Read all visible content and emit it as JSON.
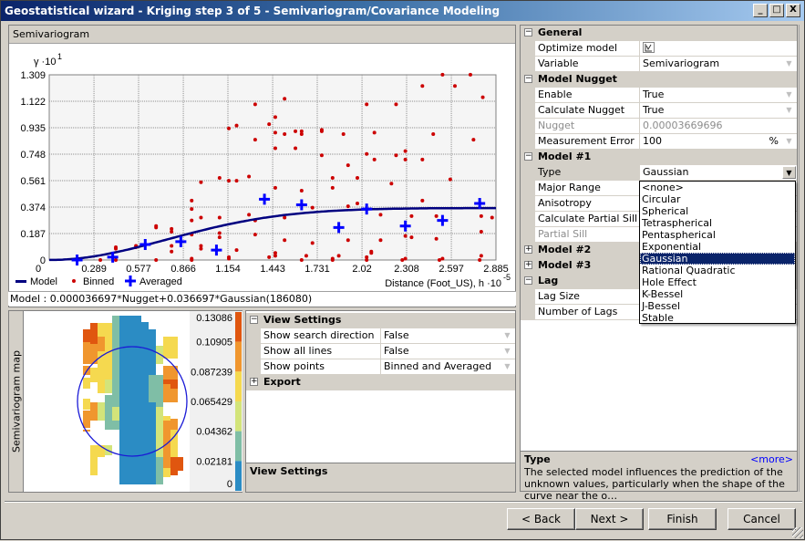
{
  "window": {
    "title": "Geostatistical wizard - Kriging step 3 of 5 - Semivariogram/Covariance Modeling",
    "controls": [
      "_",
      "□",
      "X"
    ]
  },
  "chart_panel": {
    "header": "Semivariogram",
    "model_text": "Model : 0.000036697*Nugget+0.036697*Gaussian(186080)"
  },
  "chart_data": {
    "type": "scatter",
    "title": "Semivariogram",
    "ylabel": "γ ·10",
    "ylabel_exp": "1",
    "xlabel": "Distance (Foot_US), h ·10",
    "xlabel_exp": "-5",
    "xlim": [
      0,
      2.885
    ],
    "ylim": [
      0,
      1.309
    ],
    "x_ticks": [
      "0",
      "0.289",
      "0.577",
      "0.866",
      "1.154",
      "1.443",
      "1.731",
      "2.02",
      "2.308",
      "2.597",
      "2.885"
    ],
    "y_ticks": [
      "0",
      "0.187",
      "0.374",
      "0.561",
      "0.748",
      "0.935",
      "1.122",
      "1.309"
    ],
    "grid": true,
    "legend": [
      {
        "name": "Model",
        "color": "#000080",
        "marker": "line"
      },
      {
        "name": "Binned",
        "color": "#cc0000",
        "marker": "dot"
      },
      {
        "name": "Averaged",
        "color": "#0000ff",
        "marker": "cross"
      }
    ],
    "legend_position": "bottom-left",
    "model": {
      "type": "gaussian",
      "nugget": 0.00036697,
      "partial_sill": 0.36697,
      "range": 1.8608
    },
    "averaged": [
      {
        "x": 0.18,
        "y": 0.0
      },
      {
        "x": 0.41,
        "y": 0.02
      },
      {
        "x": 0.62,
        "y": 0.11
      },
      {
        "x": 0.85,
        "y": 0.13
      },
      {
        "x": 1.08,
        "y": 0.07
      },
      {
        "x": 1.39,
        "y": 0.43
      },
      {
        "x": 1.63,
        "y": 0.39
      },
      {
        "x": 1.87,
        "y": 0.23
      },
      {
        "x": 2.05,
        "y": 0.36
      },
      {
        "x": 2.3,
        "y": 0.24
      },
      {
        "x": 2.54,
        "y": 0.28
      },
      {
        "x": 2.78,
        "y": 0.4
      }
    ],
    "binned": [
      {
        "x": 0.33,
        "y": 0.0
      },
      {
        "x": 0.43,
        "y": 0.09
      },
      {
        "x": 0.43,
        "y": 0.08
      },
      {
        "x": 0.43,
        "y": 0.0
      },
      {
        "x": 0.56,
        "y": 0.1
      },
      {
        "x": 0.56,
        "y": 0.09
      },
      {
        "x": 0.69,
        "y": 0.24
      },
      {
        "x": 0.69,
        "y": 0.23
      },
      {
        "x": 0.69,
        "y": 0.0
      },
      {
        "x": 0.79,
        "y": 0.22
      },
      {
        "x": 0.79,
        "y": 0.2
      },
      {
        "x": 0.79,
        "y": 0.1
      },
      {
        "x": 0.79,
        "y": 0.06
      },
      {
        "x": 0.92,
        "y": 0.42
      },
      {
        "x": 0.92,
        "y": 0.36
      },
      {
        "x": 0.92,
        "y": 0.28
      },
      {
        "x": 0.92,
        "y": 0.18
      },
      {
        "x": 0.92,
        "y": 0.0
      },
      {
        "x": 0.92,
        "y": 0.01
      },
      {
        "x": 0.98,
        "y": 0.55
      },
      {
        "x": 0.98,
        "y": 0.3
      },
      {
        "x": 0.98,
        "y": 0.1
      },
      {
        "x": 0.98,
        "y": 0.08
      },
      {
        "x": 1.1,
        "y": 0.58
      },
      {
        "x": 1.1,
        "y": 0.3
      },
      {
        "x": 1.1,
        "y": 0.19
      },
      {
        "x": 1.1,
        "y": 0.16
      },
      {
        "x": 1.16,
        "y": 0.93
      },
      {
        "x": 1.16,
        "y": 0.56
      },
      {
        "x": 1.16,
        "y": 0.01
      },
      {
        "x": 1.16,
        "y": 0.02
      },
      {
        "x": 1.21,
        "y": 0.95
      },
      {
        "x": 1.21,
        "y": 0.56
      },
      {
        "x": 1.21,
        "y": 0.07
      },
      {
        "x": 1.29,
        "y": 0.59
      },
      {
        "x": 1.29,
        "y": 0.32
      },
      {
        "x": 1.33,
        "y": 1.1
      },
      {
        "x": 1.33,
        "y": 0.85
      },
      {
        "x": 1.33,
        "y": 0.28
      },
      {
        "x": 1.33,
        "y": 0.18
      },
      {
        "x": 1.42,
        "y": 0.96
      },
      {
        "x": 1.42,
        "y": 0.02
      },
      {
        "x": 1.46,
        "y": 1.01
      },
      {
        "x": 1.46,
        "y": 0.9
      },
      {
        "x": 1.46,
        "y": 0.79
      },
      {
        "x": 1.46,
        "y": 0.51
      },
      {
        "x": 1.46,
        "y": 0.05
      },
      {
        "x": 1.46,
        "y": 0.03
      },
      {
        "x": 1.52,
        "y": 1.14
      },
      {
        "x": 1.52,
        "y": 0.89
      },
      {
        "x": 1.52,
        "y": 0.3
      },
      {
        "x": 1.52,
        "y": 0.14
      },
      {
        "x": 1.59,
        "y": 0.91
      },
      {
        "x": 1.59,
        "y": 0.79
      },
      {
        "x": 1.63,
        "y": 0.91
      },
      {
        "x": 1.63,
        "y": 0.89
      },
      {
        "x": 1.63,
        "y": 0.49
      },
      {
        "x": 1.63,
        "y": 0.0
      },
      {
        "x": 1.66,
        "y": 0.03
      },
      {
        "x": 1.7,
        "y": 0.37
      },
      {
        "x": 1.7,
        "y": 0.12
      },
      {
        "x": 1.76,
        "y": 0.92
      },
      {
        "x": 1.76,
        "y": 0.91
      },
      {
        "x": 1.76,
        "y": 0.74
      },
      {
        "x": 1.83,
        "y": 0.58
      },
      {
        "x": 1.83,
        "y": 0.51
      },
      {
        "x": 1.83,
        "y": 0.01
      },
      {
        "x": 1.83,
        "y": 0.0
      },
      {
        "x": 1.87,
        "y": 0.03
      },
      {
        "x": 1.9,
        "y": 0.89
      },
      {
        "x": 1.93,
        "y": 0.67
      },
      {
        "x": 1.93,
        "y": 0.38
      },
      {
        "x": 1.93,
        "y": 0.14
      },
      {
        "x": 1.99,
        "y": 0.58
      },
      {
        "x": 1.99,
        "y": 0.4
      },
      {
        "x": 2.05,
        "y": 1.1
      },
      {
        "x": 2.05,
        "y": 0.75
      },
      {
        "x": 2.05,
        "y": 0.0
      },
      {
        "x": 2.05,
        "y": 0.02
      },
      {
        "x": 2.08,
        "y": 0.05
      },
      {
        "x": 2.08,
        "y": 0.06
      },
      {
        "x": 2.1,
        "y": 0.9
      },
      {
        "x": 2.1,
        "y": 0.71
      },
      {
        "x": 2.14,
        "y": 0.32
      },
      {
        "x": 2.14,
        "y": 0.14
      },
      {
        "x": 2.24,
        "y": 1.1
      },
      {
        "x": 2.24,
        "y": 0.74
      },
      {
        "x": 2.21,
        "y": 0.54
      },
      {
        "x": 2.3,
        "y": 0.77
      },
      {
        "x": 2.3,
        "y": 0.71
      },
      {
        "x": 2.3,
        "y": 0.17
      },
      {
        "x": 2.3,
        "y": 0.01
      },
      {
        "x": 2.28,
        "y": 0.0
      },
      {
        "x": 2.34,
        "y": 0.31
      },
      {
        "x": 2.34,
        "y": 0.16
      },
      {
        "x": 2.41,
        "y": 0.71
      },
      {
        "x": 2.41,
        "y": 0.42
      },
      {
        "x": 2.41,
        "y": 1.23
      },
      {
        "x": 2.48,
        "y": 0.89
      },
      {
        "x": 2.5,
        "y": 0.31
      },
      {
        "x": 2.5,
        "y": 0.15
      },
      {
        "x": 2.52,
        "y": 0.0
      },
      {
        "x": 2.54,
        "y": 0.01
      },
      {
        "x": 2.54,
        "y": 1.31
      },
      {
        "x": 2.59,
        "y": 0.57
      },
      {
        "x": 2.62,
        "y": 1.23
      },
      {
        "x": 2.72,
        "y": 1.31
      },
      {
        "x": 2.74,
        "y": 0.85
      },
      {
        "x": 2.8,
        "y": 1.15
      },
      {
        "x": 2.79,
        "y": 0.31
      },
      {
        "x": 2.79,
        "y": 0.2
      },
      {
        "x": 2.79,
        "y": 0.03
      },
      {
        "x": 2.78,
        "y": 0.0
      },
      {
        "x": 2.86,
        "y": 0.3
      }
    ]
  },
  "map_panel": {
    "side_label": "Semivariogram map",
    "legend_values": [
      "0.13086",
      "0.10905",
      "0.087239",
      "0.065429",
      "0.04362",
      "0.02181",
      "0"
    ],
    "legend_colors": [
      "#e0560f",
      "#f0962e",
      "#f5d94f",
      "#d3e47a",
      "#7fbea6",
      "#2b8cc4"
    ]
  },
  "view_settings": {
    "categories": [
      {
        "label": "View Settings",
        "expanded": true,
        "rows": [
          {
            "name": "Show search direction",
            "value": "False"
          },
          {
            "name": "Show all lines",
            "value": "False"
          },
          {
            "name": "Show points",
            "value": "Binned and Averaged"
          }
        ]
      },
      {
        "label": "Export",
        "expanded": false,
        "rows": []
      }
    ],
    "description_title": "View Settings"
  },
  "properties": {
    "categories": [
      {
        "label": "General",
        "expanded": true
      },
      {
        "label": "Model Nugget",
        "expanded": true
      },
      {
        "label": "Model #1",
        "expanded": true
      },
      {
        "label": "Model #2",
        "expanded": false
      },
      {
        "label": "Model #3",
        "expanded": false
      },
      {
        "label": "Lag",
        "expanded": true
      }
    ],
    "rows": {
      "optimize_model": {
        "name": "Optimize model",
        "value": ""
      },
      "variable": {
        "name": "Variable",
        "value": "Semivariogram"
      },
      "enable": {
        "name": "Enable",
        "value": "True"
      },
      "calculate_nugget": {
        "name": "Calculate Nugget",
        "value": "True"
      },
      "nugget": {
        "name": "Nugget",
        "value": "0.00003669696"
      },
      "measurement_error": {
        "name": "Measurement Error",
        "value": "100",
        "unit": "%"
      },
      "type": {
        "name": "Type",
        "value": "Gaussian"
      },
      "major_range": {
        "name": "Major Range",
        "value": ""
      },
      "anisotropy": {
        "name": "Anisotropy",
        "value": ""
      },
      "calculate_partial_sill": {
        "name": "Calculate Partial Sill",
        "value": ""
      },
      "partial_sill": {
        "name": "Partial Sill",
        "value": ""
      },
      "lag_size": {
        "name": "Lag Size",
        "value": ""
      },
      "number_of_lags": {
        "name": "Number of Lags",
        "value": ""
      }
    },
    "type_options": [
      "<none>",
      "Circular",
      "Spherical",
      "Tetraspherical",
      "Pentaspherical",
      "Exponential",
      "Gaussian",
      "Rational Quadratic",
      "Hole Effect",
      "K-Bessel",
      "J-Bessel",
      "Stable"
    ],
    "type_selected": "Gaussian",
    "description": {
      "title": "Type",
      "more": "<more>",
      "text": "The selected model influences the prediction of the unknown values, particularly when the shape of the curve near the o…"
    }
  },
  "buttons": {
    "back": "< Back",
    "next": "Next >",
    "finish": "Finish",
    "cancel": "Cancel"
  }
}
